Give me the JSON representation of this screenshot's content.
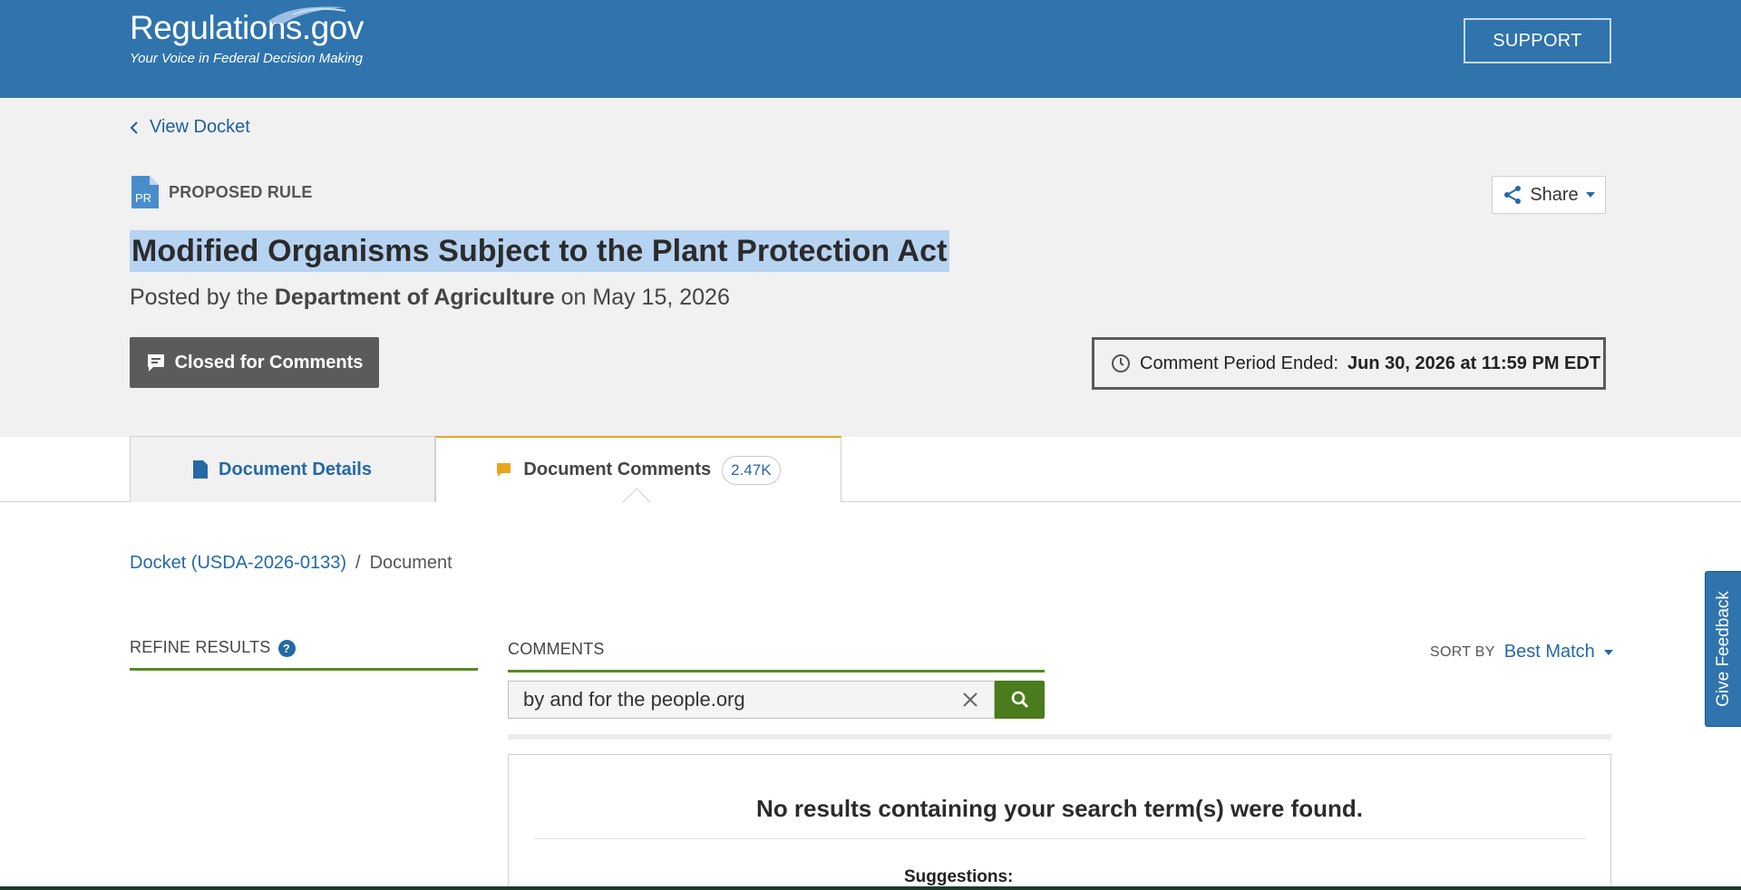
{
  "header": {
    "logo_title": "Regulations.gov",
    "logo_tagline": "Your Voice in Federal Decision Making",
    "support_label": "SUPPORT"
  },
  "hero": {
    "back_link": "View Docket",
    "doc_type_badge": "PR",
    "doc_type_label": "PROPOSED RULE",
    "share_label": "Share",
    "title": "Modified Organisms Subject to the Plant Protection Act",
    "posted_prefix": "Posted by the",
    "posted_agency": "Department of Agriculture",
    "posted_suffix": "on May 15, 2026",
    "closed_label": "Closed for Comments",
    "period_label": "Comment Period Ended:",
    "period_value": "Jun 30, 2026 at 11:59 PM EDT"
  },
  "tabs": [
    {
      "label": "Document Details"
    },
    {
      "label": "Document Comments",
      "badge": "2.47K"
    }
  ],
  "breadcrumb": {
    "docket": "Docket (USDA-2026-0133)",
    "separator": "/",
    "current": "Document"
  },
  "refine": {
    "label": "REFINE RESULTS",
    "help": "?"
  },
  "comments": {
    "label": "COMMENTS",
    "sort_label": "SORT BY",
    "sort_value": "Best Match",
    "search_value": "by and for the people.org",
    "no_results": "No results containing your search term(s) were found.",
    "suggestions": "Suggestions:"
  },
  "feedback_label": "Give Feedback",
  "colors": {
    "header_blue": "#2f74ad",
    "link_blue": "#2469a5",
    "accent_green": "#568a24",
    "tab_orange": "#e7a51f",
    "highlight": "#b7d3f2"
  }
}
